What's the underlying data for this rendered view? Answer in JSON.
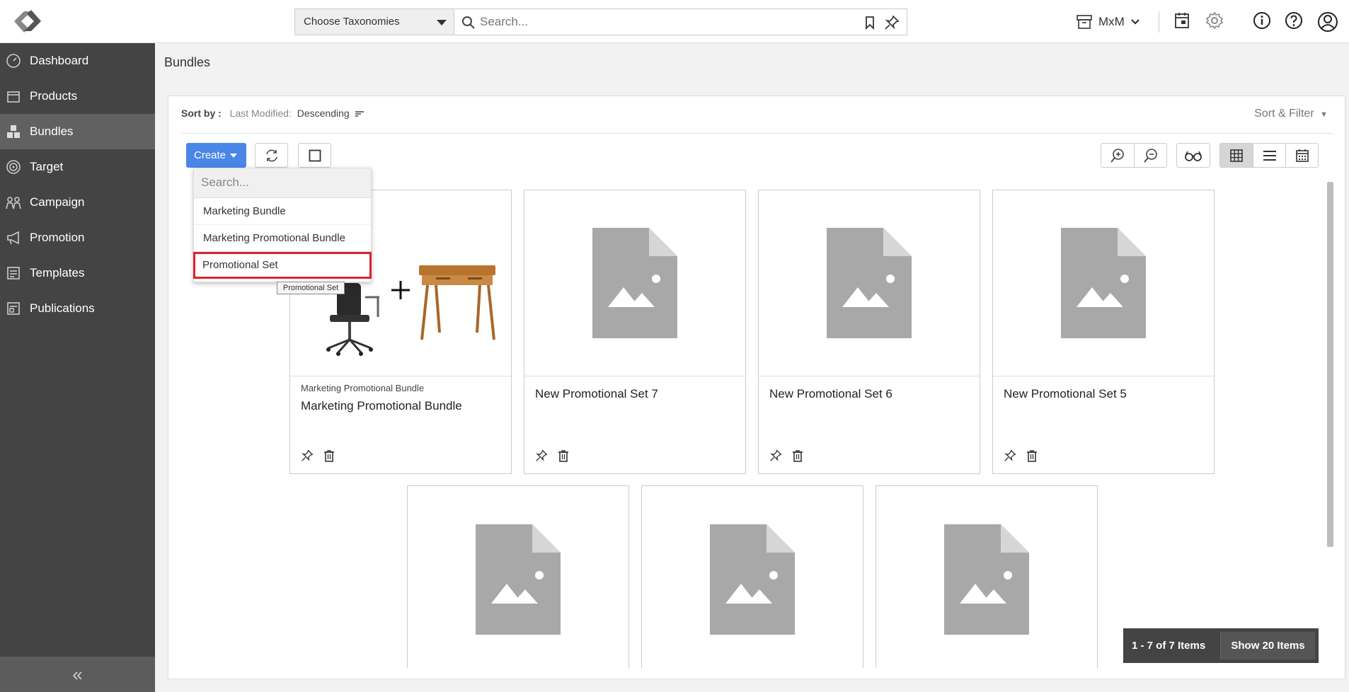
{
  "header": {
    "taxonomy_placeholder": "Choose Taxonomies",
    "search_placeholder": "Search...",
    "tenant": "MxM"
  },
  "sidebar": {
    "items": [
      {
        "label": "Dashboard",
        "icon": "dashboard-icon"
      },
      {
        "label": "Products",
        "icon": "products-icon"
      },
      {
        "label": "Bundles",
        "icon": "bundles-icon",
        "active": true
      },
      {
        "label": "Target",
        "icon": "target-icon"
      },
      {
        "label": "Campaign",
        "icon": "campaign-icon"
      },
      {
        "label": "Promotion",
        "icon": "promotion-icon"
      },
      {
        "label": "Templates",
        "icon": "templates-icon"
      },
      {
        "label": "Publications",
        "icon": "publications-icon"
      }
    ],
    "collapse_glyph": "«"
  },
  "page": {
    "title": "Bundles"
  },
  "sort": {
    "label": "Sort by :",
    "field": "Last Modified:",
    "direction": "Descending",
    "filter_label": "Sort & Filter"
  },
  "toolbar": {
    "create_label": "Create"
  },
  "dropdown": {
    "search_placeholder": "Search...",
    "items": [
      "Marketing Bundle",
      "Marketing Promotional Bundle",
      "Promotional Set"
    ],
    "tooltip": "Promotional Set"
  },
  "cards": [
    {
      "subtitle": "Marketing Promotional Bundle",
      "title": "Marketing Promotional Bundle"
    },
    {
      "subtitle": "",
      "title": "New Promotional Set 7"
    },
    {
      "subtitle": "",
      "title": "New Promotional Set 6"
    },
    {
      "subtitle": "",
      "title": "New Promotional Set 5"
    },
    {
      "subtitle": "",
      "title": ""
    },
    {
      "subtitle": "",
      "title": ""
    },
    {
      "subtitle": "",
      "title": ""
    }
  ],
  "pager": {
    "range": "1 - 7 of 7 Items",
    "show": "Show 20 Items"
  },
  "colors": {
    "accent": "#4a86e8",
    "sidebar": "#444444",
    "highlight": "#d9232e"
  }
}
